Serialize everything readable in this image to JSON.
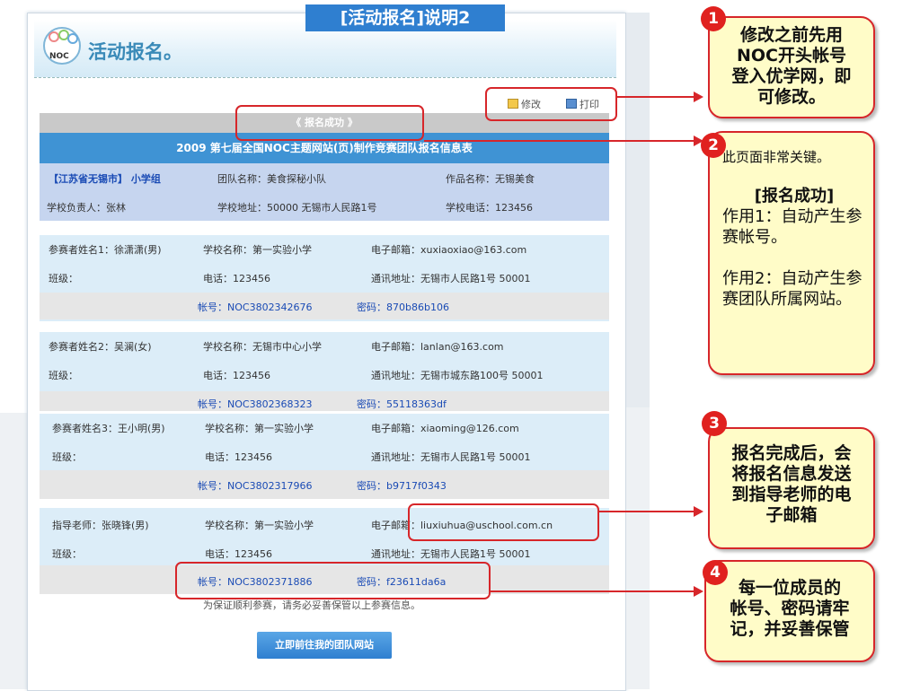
{
  "banner_title": "[活动报名]说明2",
  "header": {
    "title": "活动报名。",
    "logo_text": "NOC"
  },
  "toolbar": {
    "edit_label": "修改",
    "print_label": "打印"
  },
  "success_label": "《 报名成功 》",
  "table_title": "2009 第七届全国NOC主题网站(页)制作竞赛团队报名信息表",
  "team": {
    "region": "【江苏省无锡市】 小学组",
    "team_name": "团队名称：美食探秘小队",
    "work_name": "作品名称：无锡美食",
    "principal": "学校负责人：张林",
    "address": "学校地址：50000 无锡市人民路1号",
    "phone": "学校电话：123456"
  },
  "members": [
    {
      "name": "参赛者姓名1：徐潇潇(男)",
      "school": "学校名称：第一实验小学",
      "email": "电子邮箱：xuxiaoxiao@163.com",
      "class": "班级：",
      "tel": "电话：123456",
      "mail_addr": "通讯地址：无锡市人民路1号 50001",
      "account": "帐号：NOC3802342676",
      "password": "密码：870b86b106"
    },
    {
      "name": "参赛者姓名2：吴澜(女)",
      "school": "学校名称：无锡市中心小学",
      "email": "电子邮箱：lanlan@163.com",
      "class": "班级：",
      "tel": "电话：123456",
      "mail_addr": "通讯地址：无锡市城东路100号 50001",
      "account": "帐号：NOC3802368323",
      "password": "密码：55118363df"
    },
    {
      "name": "参赛者姓名3：王小明(男)",
      "school": "学校名称：第一实验小学",
      "email": "电子邮箱：xiaoming@126.com",
      "class": "班级：",
      "tel": "电话：123456",
      "mail_addr": "通讯地址：无锡市人民路1号 50001",
      "account": "帐号：NOC3802317966",
      "password": "密码：b9717f0343"
    },
    {
      "name": "指导老师：张晓锋(男)",
      "school": "学校名称：第一实验小学",
      "email": "电子邮箱：liuxiuhua@uschool.com.cn",
      "class": "班级：",
      "tel": "电话：123456",
      "mail_addr": "通讯地址：无锡市人民路1号 50001",
      "account": "帐号：NOC3802371886",
      "password": "密码：f23611da6a"
    }
  ],
  "note": "为保证顺利参赛，请务必妥善保管以上参赛信息。",
  "goto_button": "立即前往我的团队网站",
  "callouts": [
    {
      "number": "1",
      "lines": [
        "修改之前先用",
        "NOC开头帐号",
        "登入优学网，即",
        "可修改。"
      ]
    },
    {
      "number": "2",
      "line1": "此页面非常关键。",
      "line2": "[报名成功]",
      "line3": "作用1：自动产生参赛帐号。",
      "line4": "作用2：自动产生参赛团队所属网站。"
    },
    {
      "number": "3",
      "lines": [
        "报名完成后，会",
        "将报名信息发送",
        "到指导老师的电",
        "子邮箱"
      ]
    },
    {
      "number": "4",
      "lines": [
        "每一位成员的",
        "帐号、密码请牢",
        "记，并妥善保管"
      ]
    }
  ],
  "colors": {
    "accent": "#2f7fd0",
    "highlight": "#d7262a",
    "callout_bg": "#fffcc8",
    "badge": "#e0211f"
  }
}
